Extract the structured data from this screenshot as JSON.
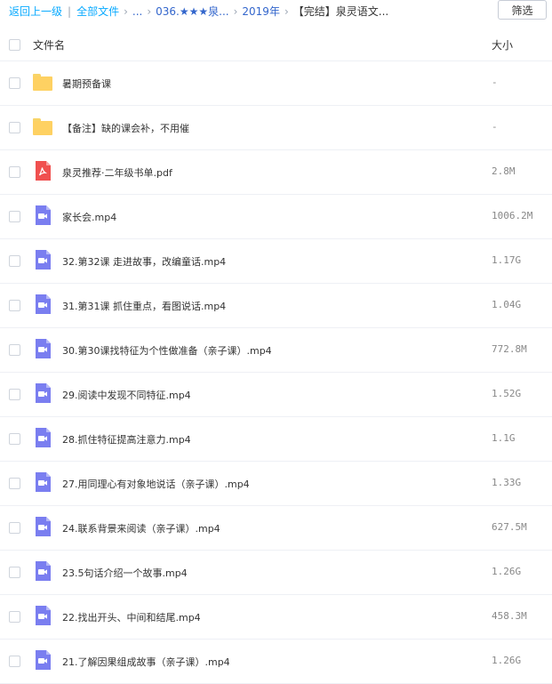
{
  "breadcrumb": {
    "back": "返回上一级",
    "all_files": "全部文件",
    "ellipsis": "...",
    "level1": "036.★★★泉...",
    "level2": "2019年",
    "current": "【完结】泉灵语文..."
  },
  "toolbar": {
    "filter_label": "筛选"
  },
  "table": {
    "col_name": "文件名",
    "col_size": "大小"
  },
  "files": [
    {
      "type": "folder",
      "name": "暑期预备课",
      "size": "-"
    },
    {
      "type": "folder",
      "name": "【备注】缺的课会补，不用催",
      "size": "-"
    },
    {
      "type": "pdf",
      "name": "泉灵推荐·二年级书单.pdf",
      "size": "2.8M"
    },
    {
      "type": "video",
      "name": "家长会.mp4",
      "size": "1006.2M"
    },
    {
      "type": "video",
      "name": "32.第32课 走进故事，改编童话.mp4",
      "size": "1.17G"
    },
    {
      "type": "video",
      "name": "31.第31课 抓住重点，看图说话.mp4",
      "size": "1.04G"
    },
    {
      "type": "video",
      "name": "30.第30课找特征为个性做准备（亲子课）.mp4",
      "size": "772.8M"
    },
    {
      "type": "video",
      "name": "29.阅读中发现不同特征.mp4",
      "size": "1.52G"
    },
    {
      "type": "video",
      "name": "28.抓住特征提高注意力.mp4",
      "size": "1.1G"
    },
    {
      "type": "video",
      "name": "27.用同理心有对象地说话（亲子课）.mp4",
      "size": "1.33G"
    },
    {
      "type": "video",
      "name": "24.联系背景来阅读（亲子课）.mp4",
      "size": "627.5M"
    },
    {
      "type": "video",
      "name": "23.5句话介绍一个故事.mp4",
      "size": "1.26G"
    },
    {
      "type": "video",
      "name": "22.找出开头、中间和结尾.mp4",
      "size": "458.3M"
    },
    {
      "type": "video",
      "name": "21.了解因果组成故事（亲子课）.mp4",
      "size": "1.26G"
    }
  ],
  "colors": {
    "link": "#09aaff",
    "folder": "#fed162",
    "pdf": "#f0504f",
    "video": "#7a7ef0"
  }
}
